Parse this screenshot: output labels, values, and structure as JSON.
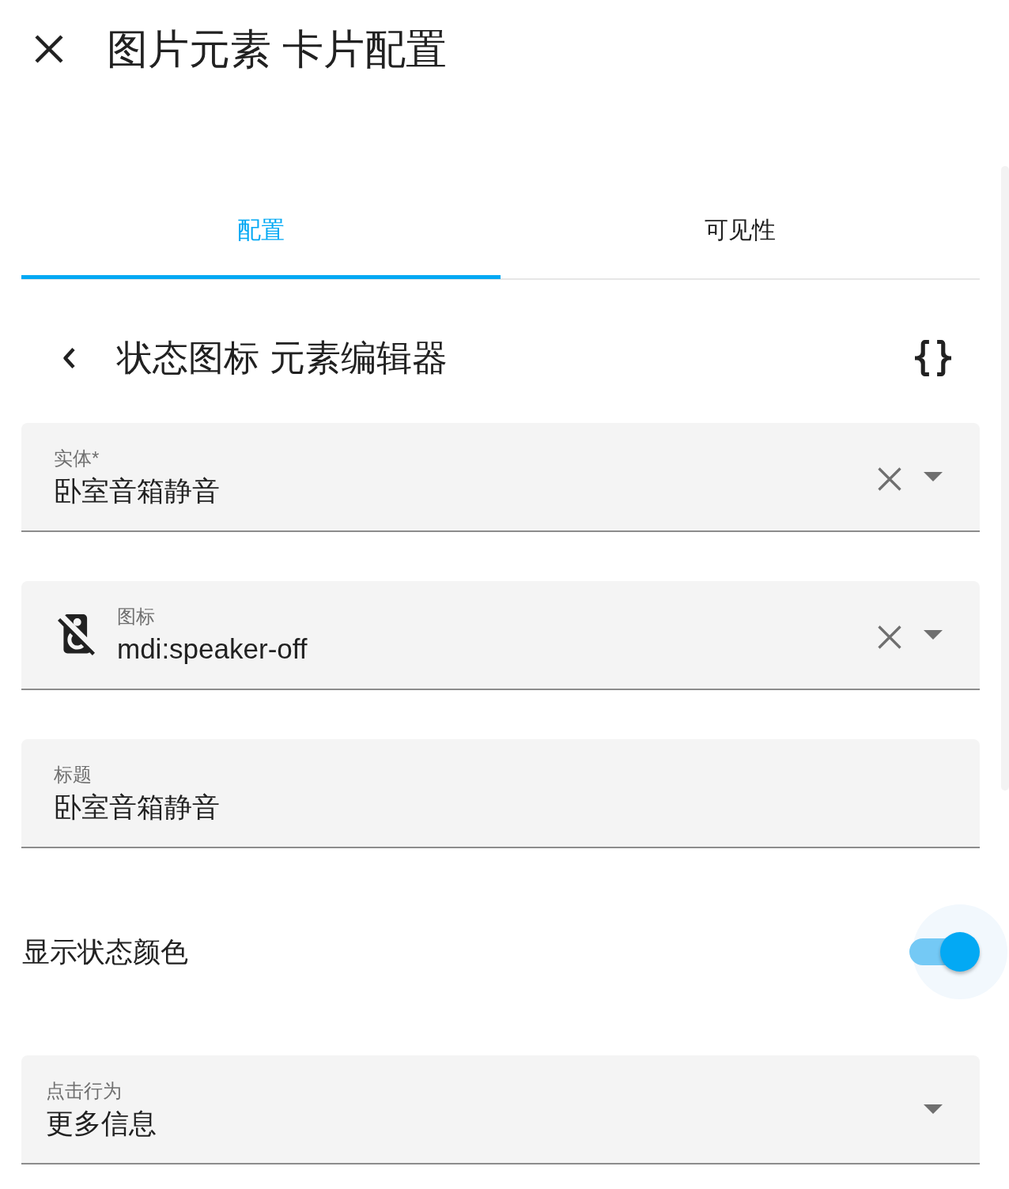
{
  "dialog": {
    "title": "图片元素 卡片配置"
  },
  "tabs": [
    {
      "label": "配置",
      "selected": true
    },
    {
      "label": "可见性",
      "selected": false
    }
  ],
  "editor": {
    "title": "状态图标 元素编辑器"
  },
  "fields": [
    {
      "kind": "combobox",
      "label": "实体*",
      "value": "卧室音箱静音",
      "clearable": true
    },
    {
      "kind": "icon_picker",
      "label": "图标",
      "value": "mdi:speaker-off",
      "clearable": true
    },
    {
      "kind": "text",
      "label": "标题",
      "value": "卧室音箱静音"
    },
    {
      "kind": "switch",
      "label": "显示状态颜色",
      "on": true
    },
    {
      "kind": "select",
      "label": "点击行为",
      "value": "更多信息"
    }
  ]
}
